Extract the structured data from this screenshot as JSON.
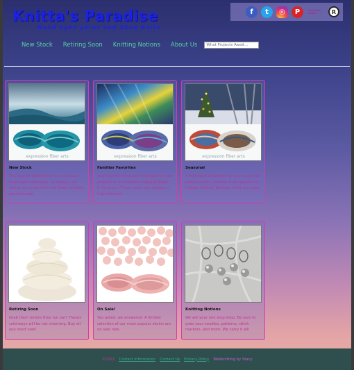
{
  "header": {
    "title": "Knitta's Paradise",
    "tagline": "Hand dyed yarns and Shop Knits"
  },
  "social": {
    "icons": [
      "facebook-icon",
      "twitter-icon",
      "instagram-icon",
      "pinterest-icon",
      "ravelry-icon"
    ],
    "fb_glyph": "f",
    "tw_glyph": "t",
    "ig_glyph": "◎",
    "pt_glyph": "P",
    "ravelry_glyph": "R"
  },
  "nav": {
    "items": [
      "New Stock",
      "Retiring Soon",
      "Knitting Notions",
      "About Us"
    ],
    "search_placeholder": "What Projects Await..."
  },
  "cards": [
    {
      "title": "New Stock",
      "desc": "The newest additions of our exclusive hand-dyed colorways. As always, our skeins are made from the finest ethically sourced wool.",
      "watermark": "expression fiber arts"
    },
    {
      "title": "Familiar Favorites",
      "desc": "Your favorite colorways available for new projects or to complete ongoing Works In Progress! These colors are always in high demand.",
      "watermark": "expression fiber arts"
    },
    {
      "title": "Seasonal",
      "desc": "A multitude of options for your seasonal project needs, whether it be weather or holiday related. We have what you need.",
      "watermark": "expression fiber arts"
    },
    {
      "title": "Retiring Soon",
      "desc": "Grab them before they run out! Theses colorways will be not returning. Buy all you need now!"
    },
    {
      "title": "On Sale!",
      "desc": "You asked, we answered. A limited selection of our most popular skeins are on sale now."
    },
    {
      "title": "Knitting Notions",
      "desc": "We are your one stop shop. Be sure to grab your needles, patterns, stitch markers, and more. We carry it all!"
    }
  ],
  "footer": {
    "copyright": "©2021",
    "links": [
      "Contact Information",
      "Contact Us",
      "Privacy Policy"
    ],
    "credit": "Webknitting by Stacy"
  },
  "colors": {
    "title": "#1c22e0",
    "nav_link": "#56d4a2",
    "card_border": "#d33bb0",
    "desc_text": "#c0309a",
    "footer_bg": "#2f4f4f"
  }
}
